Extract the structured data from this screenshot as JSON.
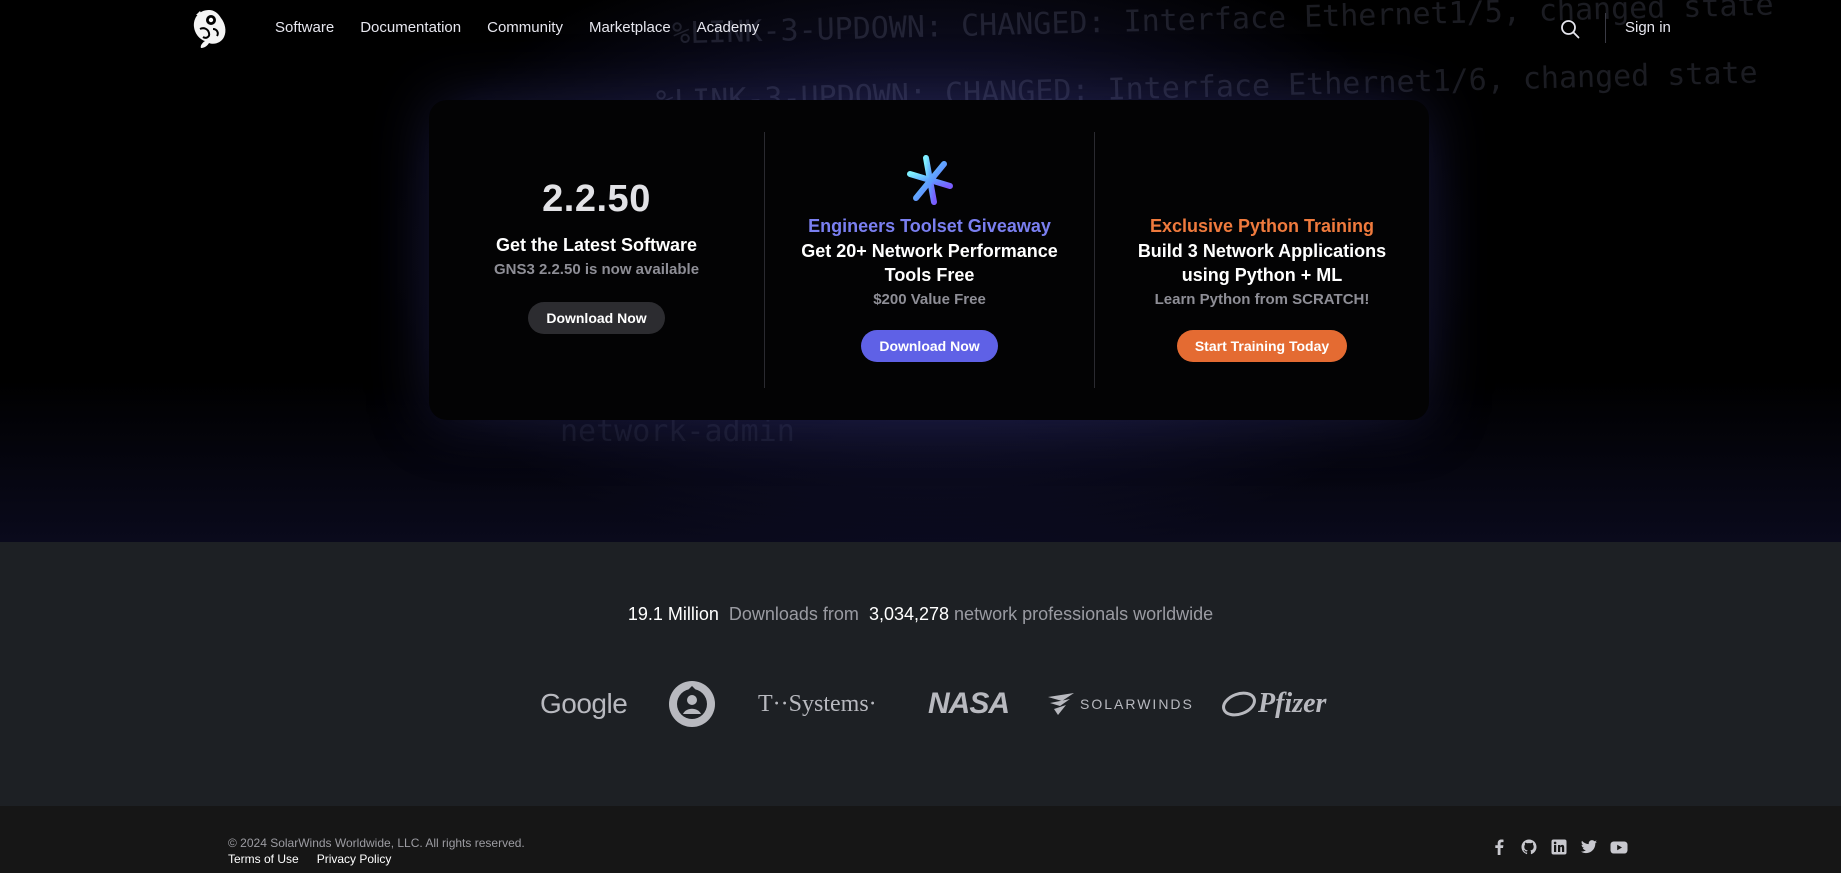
{
  "nav": {
    "links": [
      "Software",
      "Documentation",
      "Community",
      "Marketplace",
      "Academy"
    ],
    "signin_label": "Sign in"
  },
  "hero": {
    "code_lines": [
      "%LINK-3-UPDOWN: CHANGED: Interface Ethernet1/5, changed state",
      "%LINK-3-UPDOWN: CHANGED: Interface Ethernet1/6, changed state",
      "network-admin"
    ]
  },
  "promo": {
    "software": {
      "version": "2.2.50",
      "title": "Get the Latest Software",
      "subtitle": "GNS3 2.2.50 is now available",
      "button": "Download Now"
    },
    "toolset": {
      "accent": "Engineers Toolset Giveaway",
      "title": "Get 20+ Network Performance Tools Free",
      "subtitle": "$200 Value Free",
      "button": "Download Now"
    },
    "python": {
      "accent": "Exclusive Python Training",
      "title": "Build 3 Network Applications using Python + ML",
      "subtitle": "Learn Python from SCRATCH!",
      "button": "Start Training Today"
    }
  },
  "stats": {
    "downloads": "19.1 Million",
    "downloads_text": "Downloads from",
    "professionals": "3,034,278",
    "professionals_text": "network professionals worldwide"
  },
  "brands": {
    "google": "Google",
    "tsystems": "T··Systems·",
    "nasa": "NASA",
    "solarwinds": "SOLARWINDS",
    "pfizer": "Pfizer"
  },
  "footer": {
    "copyright": "© 2024 SolarWinds Worldwide, LLC. All rights reserved.",
    "terms": "Terms of Use",
    "privacy": "Privacy Policy",
    "social_icons": [
      "facebook-icon",
      "github-icon",
      "linkedin-icon",
      "twitter-icon",
      "youtube-icon"
    ]
  },
  "colors": {
    "accent_purple": "#5f61e6",
    "accent_orange": "#e46b32"
  }
}
